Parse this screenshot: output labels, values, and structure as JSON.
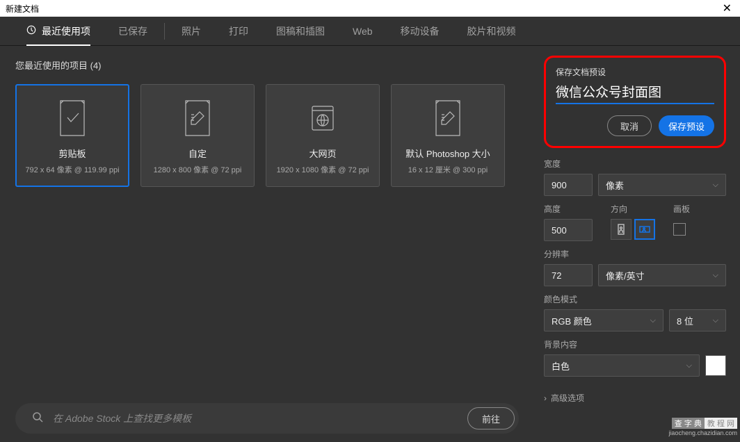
{
  "titlebar": {
    "title": "新建文档",
    "close": "✕"
  },
  "tabs": {
    "recent": "最近使用项",
    "saved": "已保存",
    "photo": "照片",
    "print": "打印",
    "art": "图稿和插图",
    "web": "Web",
    "mobile": "移动设备",
    "film": "胶片和视频"
  },
  "recent_label": "您最近使用的项目 (4)",
  "cards": [
    {
      "title": "剪贴板",
      "subtitle": "792 x 64 像素 @ 119.99 ppi"
    },
    {
      "title": "自定",
      "subtitle": "1280 x 800 像素 @ 72 ppi"
    },
    {
      "title": "大网页",
      "subtitle": "1920 x 1080 像素 @ 72 ppi"
    },
    {
      "title": "默认 Photoshop 大小",
      "subtitle": "16 x 12 厘米 @ 300 ppi"
    }
  ],
  "search": {
    "placeholder": "在 Adobe Stock 上查找更多模板",
    "go": "前往"
  },
  "preset": {
    "label": "保存文档预设",
    "name": "微信公众号封面图",
    "cancel": "取消",
    "save": "保存预设"
  },
  "fields": {
    "width_label": "宽度",
    "width_value": "900",
    "width_unit": "像素",
    "height_label": "高度",
    "height_value": "500",
    "orientation_label": "方向",
    "artboard_label": "画板",
    "resolution_label": "分辨率",
    "resolution_value": "72",
    "resolution_unit": "像素/英寸",
    "colormode_label": "颜色模式",
    "colormode_value": "RGB 颜色",
    "colordepth_value": "8 位",
    "bg_label": "背景内容",
    "bg_value": "白色",
    "advanced": "高级选项"
  },
  "watermark": {
    "a": "查 字 典",
    "b": "教 程 网",
    "url": "jiaocheng.chazidian.com"
  }
}
